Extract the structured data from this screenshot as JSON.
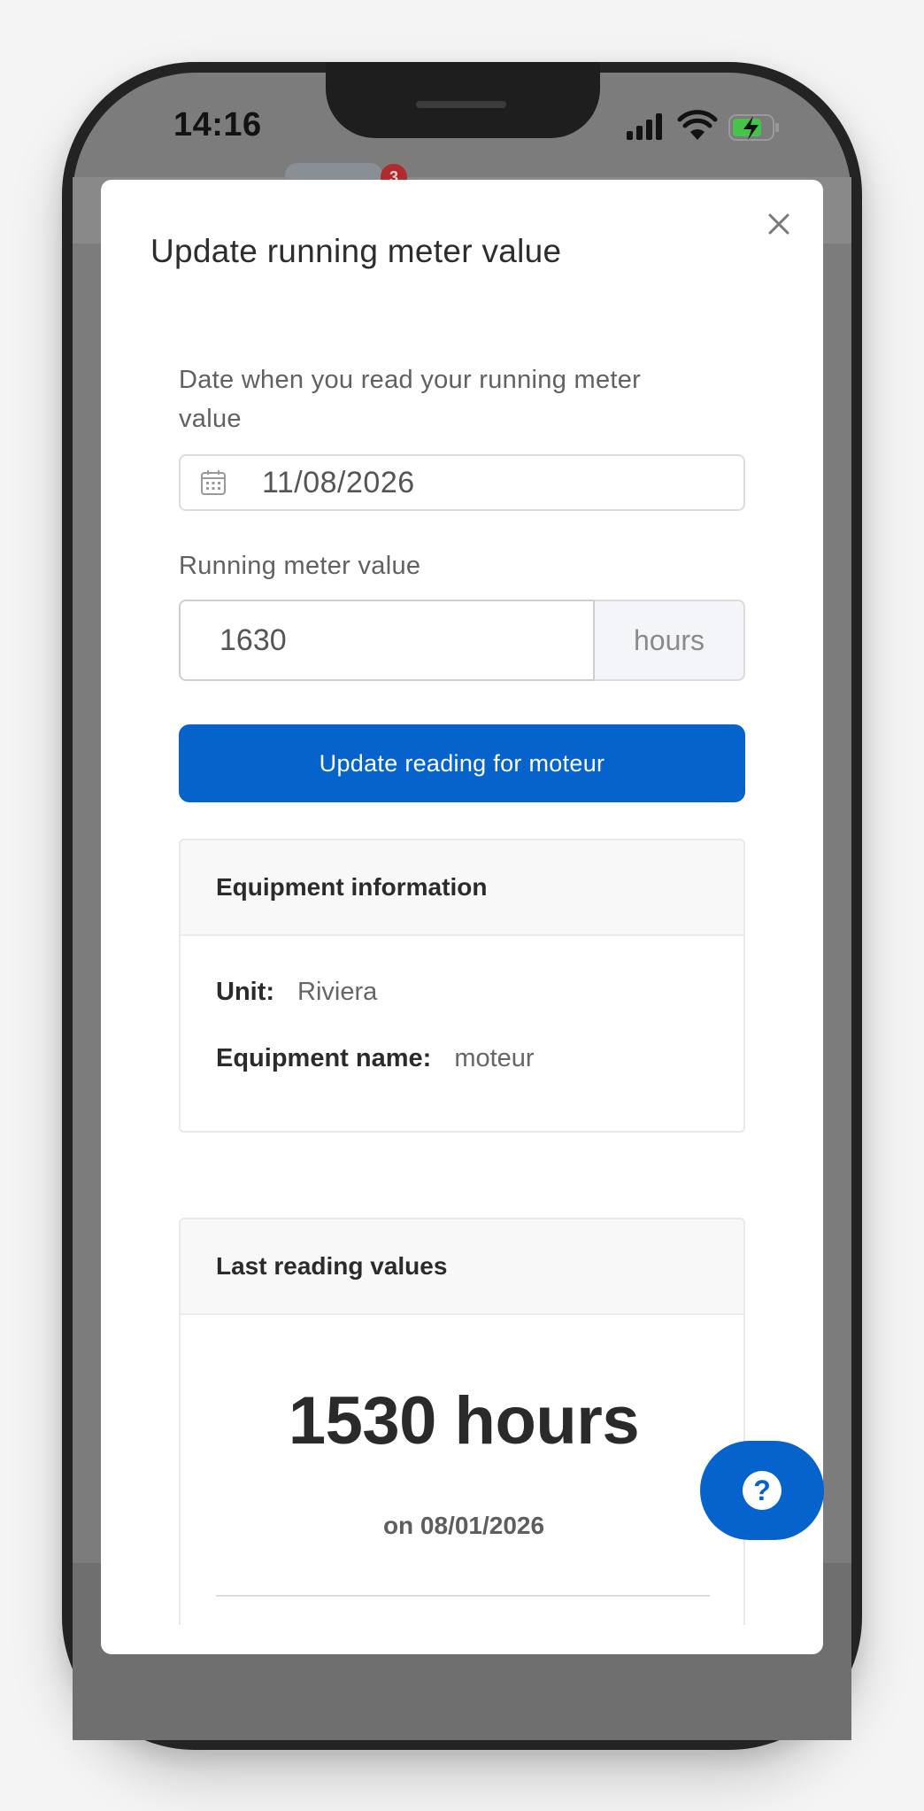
{
  "status_bar": {
    "time": "14:16"
  },
  "background": {
    "badge_count": "3"
  },
  "modal": {
    "title": "Update running meter value",
    "date_label": "Date when you read your running meter value",
    "date_value": "11/08/2026",
    "meter_label": "Running meter value",
    "meter_value": "1630",
    "meter_unit": "hours",
    "submit_label": "Update reading for moteur"
  },
  "equipment_info": {
    "title": "Equipment information",
    "unit_label": "Unit:",
    "unit_value": "Riviera",
    "equipment_label": "Equipment name:",
    "equipment_value": "moteur"
  },
  "last_reading": {
    "title": "Last reading values",
    "value": "1530 hours",
    "date": "on 08/01/2026"
  },
  "help": {
    "icon": "question-icon",
    "glyph": "?"
  },
  "colors": {
    "primary": "#0663cc",
    "overlay": "#7c7c7c"
  }
}
